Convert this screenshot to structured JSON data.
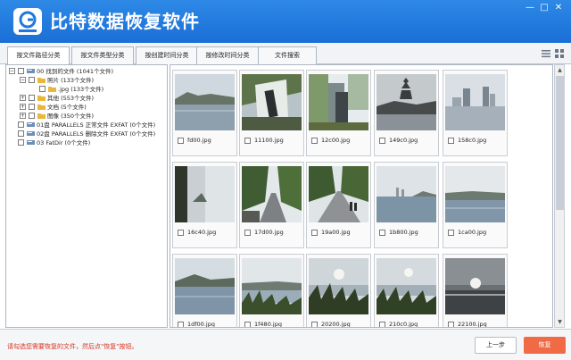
{
  "app": {
    "title": "比特数据恢复软件",
    "brand_color": "#1f77de"
  },
  "window": {
    "min": "—",
    "max": "□",
    "close": "✕"
  },
  "tabs": [
    {
      "label": "按文件路径分类",
      "active": true
    },
    {
      "label": "按文件类型分类",
      "active": false
    },
    {
      "label": "按创建时间分类",
      "active": false
    },
    {
      "label": "按修改时间分类",
      "active": false
    },
    {
      "label": "文件搜索",
      "active": false
    }
  ],
  "tree": [
    {
      "label": "00 找到的文件 (1041个文件)",
      "expander": "−",
      "icon": "drive-icon"
    },
    {
      "label": "照片 (133个文件)",
      "expander": "−",
      "icon": "folder-icon"
    },
    {
      "label": ".jpg (133个文件)",
      "expander": "",
      "icon": "folder-icon"
    },
    {
      "label": "其他 (553个文件)",
      "expander": "+",
      "icon": "folder-icon"
    },
    {
      "label": "文档 (5个文件)",
      "expander": "+",
      "icon": "folder-icon"
    },
    {
      "label": "图像 (350个文件)",
      "expander": "+",
      "icon": "folder-icon"
    },
    {
      "label": "01盘 PARALLELS 正常文件 EXFAT (0个文件)",
      "expander": "",
      "icon": "drive-icon"
    },
    {
      "label": "02盘 PARALLELS 删除文件 EXFAT (0个文件)",
      "expander": "",
      "icon": "drive-icon"
    },
    {
      "label": "03 FatDir (0个文件)",
      "expander": "",
      "icon": "drive-icon"
    }
  ],
  "thumbnails": [
    {
      "name": "fd00.jpg",
      "scene": "lake-mountain"
    },
    {
      "name": "11100.jpg",
      "scene": "sign-tilted"
    },
    {
      "name": "12c00.jpg",
      "scene": "stone-sign"
    },
    {
      "name": "149c0.jpg",
      "scene": "pagoda"
    },
    {
      "name": "158c0.jpg",
      "scene": "city-lake"
    },
    {
      "name": "16c40.jpg",
      "scene": "rotated-lake"
    },
    {
      "name": "17d00.jpg",
      "scene": "road-trees"
    },
    {
      "name": "19a00.jpg",
      "scene": "road-people"
    },
    {
      "name": "1b800.jpg",
      "scene": "lake-towers"
    },
    {
      "name": "1ca00.jpg",
      "scene": "lake-plain"
    },
    {
      "name": "1df00.jpg",
      "scene": "lake-hill"
    },
    {
      "name": "1f480.jpg",
      "scene": "grass-lake"
    },
    {
      "name": "20200.jpg",
      "scene": "grass-sun"
    },
    {
      "name": "210c0.jpg",
      "scene": "grass-sun2"
    },
    {
      "name": "22100.jpg",
      "scene": "sunset"
    }
  ],
  "footer": {
    "hint": "请勾选您需要恢复的文件，然后点\"恢复\"按钮。",
    "prev": "上一步",
    "recover": "恢复",
    "recover_color": "#ef6a45"
  },
  "icons": {
    "list_view": "list-view-icon",
    "grid_view": "grid-view-icon"
  }
}
